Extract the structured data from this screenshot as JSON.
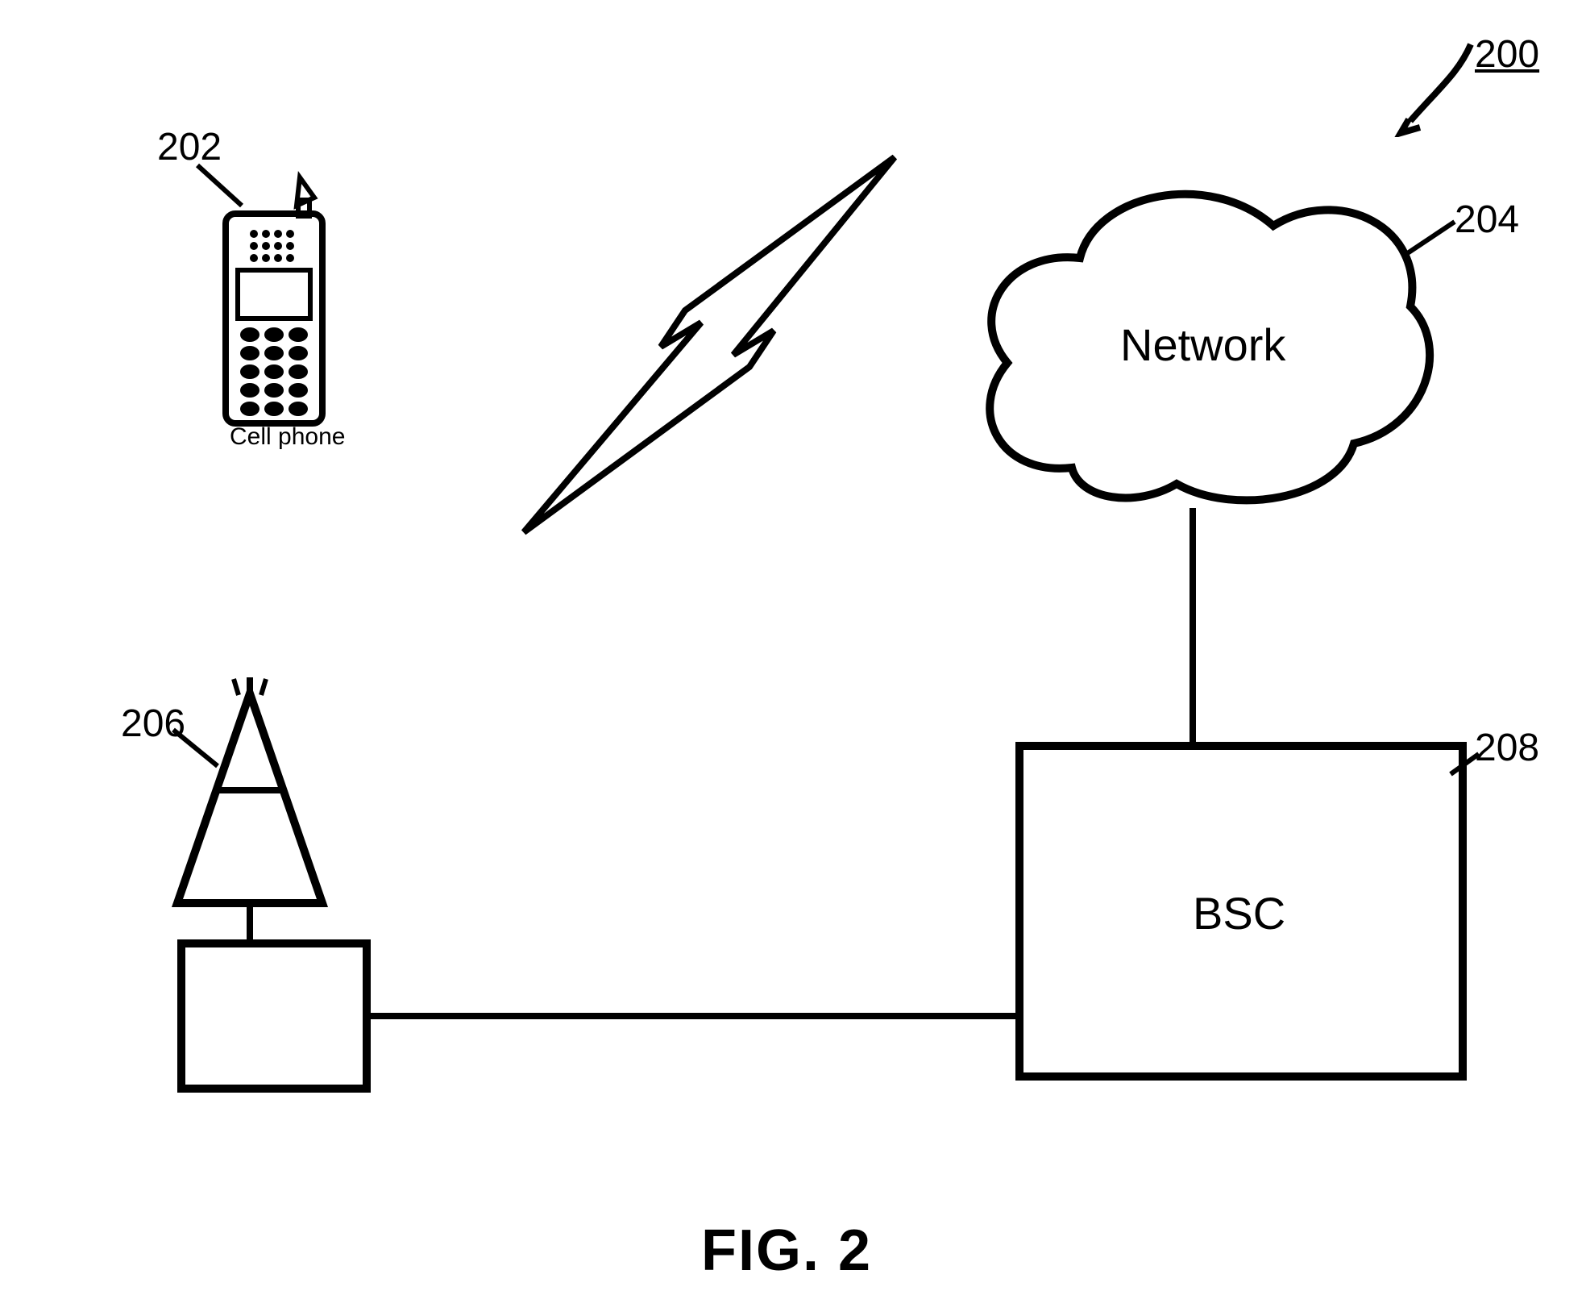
{
  "figure_number_label": "FIG. 2",
  "element_refs": {
    "system": "200",
    "phone": "202",
    "network": "204",
    "tower": "206",
    "bsc": "208"
  },
  "labels": {
    "phone_caption": "Cell phone",
    "network": "Network",
    "bsc": "BSC"
  }
}
